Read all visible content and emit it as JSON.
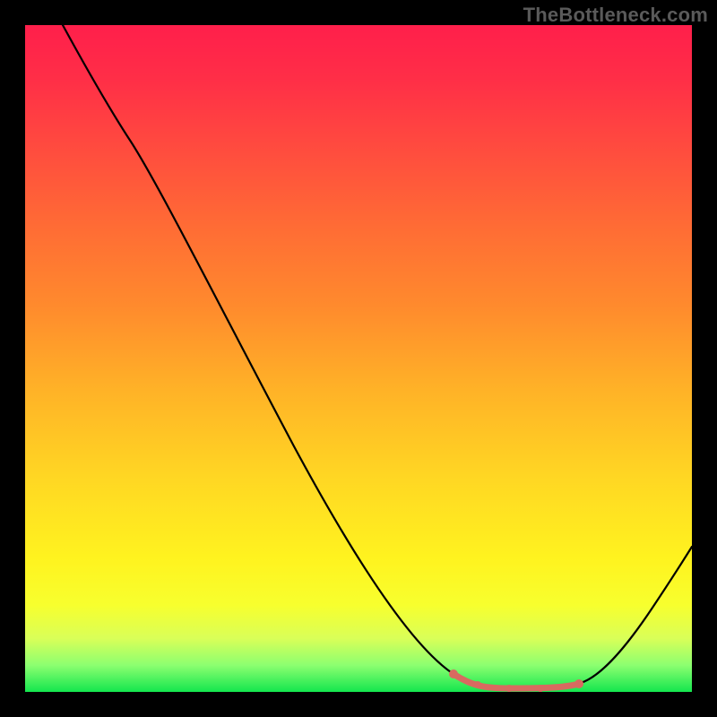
{
  "watermark": "TheBottleneck.com",
  "colors": {
    "gradient_top": "#ff1f4b",
    "gradient_mid": "#ffd723",
    "gradient_bottom": "#14e64e",
    "curve": "#000000",
    "optimum_band": "#d86a60",
    "frame_bg": "#000000"
  },
  "chart_data": {
    "type": "line",
    "title": "",
    "xlabel": "",
    "ylabel": "",
    "xlim": [
      0,
      100
    ],
    "ylim": [
      0,
      100
    ],
    "x": [
      5,
      10,
      16,
      25,
      40,
      55,
      64,
      70,
      75,
      80,
      84,
      90,
      95,
      100
    ],
    "values": [
      100,
      93,
      82,
      70,
      45,
      20,
      6,
      1,
      0,
      0,
      1,
      6,
      14,
      22
    ],
    "optimum_range_x": [
      64,
      83
    ],
    "optimum_range_value": 0,
    "note": "Values estimated from curve shape: y is bottleneck %, x is relative component balance. Axes unlabeled in source image."
  }
}
